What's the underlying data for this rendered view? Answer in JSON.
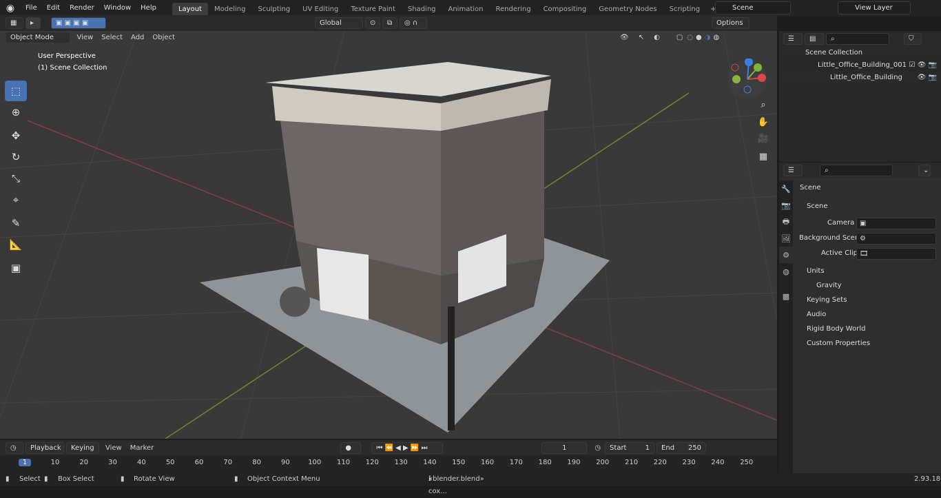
{
  "menu": [
    "File",
    "Edit",
    "Render",
    "Window",
    "Help"
  ],
  "workspaces": [
    "Layout",
    "Modeling",
    "Sculpting",
    "UV Editing",
    "Texture Paint",
    "Shading",
    "Animation",
    "Rendering",
    "Compositing",
    "Geometry Nodes",
    "Scripting"
  ],
  "scene_name": "Scene",
  "view_layer": "View Layer",
  "viewport_header": {
    "mode": "Object Mode",
    "menus": [
      "View",
      "Select",
      "Add",
      "Object"
    ],
    "transform": "Global",
    "options": "Options"
  },
  "viewport_overlay": {
    "line1": "User Perspective",
    "line2": "(1) Scene Collection"
  },
  "outliner": {
    "root": "Scene Collection",
    "collection": "Little_Office_Building_001",
    "object": "Little_Office_Building"
  },
  "properties": {
    "title": "Scene",
    "section": "Scene",
    "camera_label": "Camera",
    "bg_label": "Background Scene",
    "clip_label": "Active Clip",
    "subpanels": [
      "Units",
      "Gravity",
      "Keying Sets",
      "Audio",
      "Rigid Body World",
      "Custom Properties"
    ]
  },
  "timeline": {
    "menus": [
      "Playback",
      "Keying",
      "View",
      "Marker"
    ],
    "current_frame": "1",
    "start_label": "Start",
    "start": "1",
    "end_label": "End",
    "end": "250",
    "ticks": [
      "1",
      "10",
      "20",
      "30",
      "40",
      "50",
      "60",
      "70",
      "80",
      "90",
      "100",
      "110",
      "120",
      "130",
      "140",
      "150",
      "160",
      "170",
      "180",
      "190",
      "200",
      "210",
      "220",
      "230",
      "240",
      "250"
    ]
  },
  "status": {
    "select": "Select",
    "box_select": "Box Select",
    "rotate": "Rotate View",
    "context": "Object Context Menu",
    "file": "«blender.blend» cox...",
    "version": "2.93.18"
  }
}
